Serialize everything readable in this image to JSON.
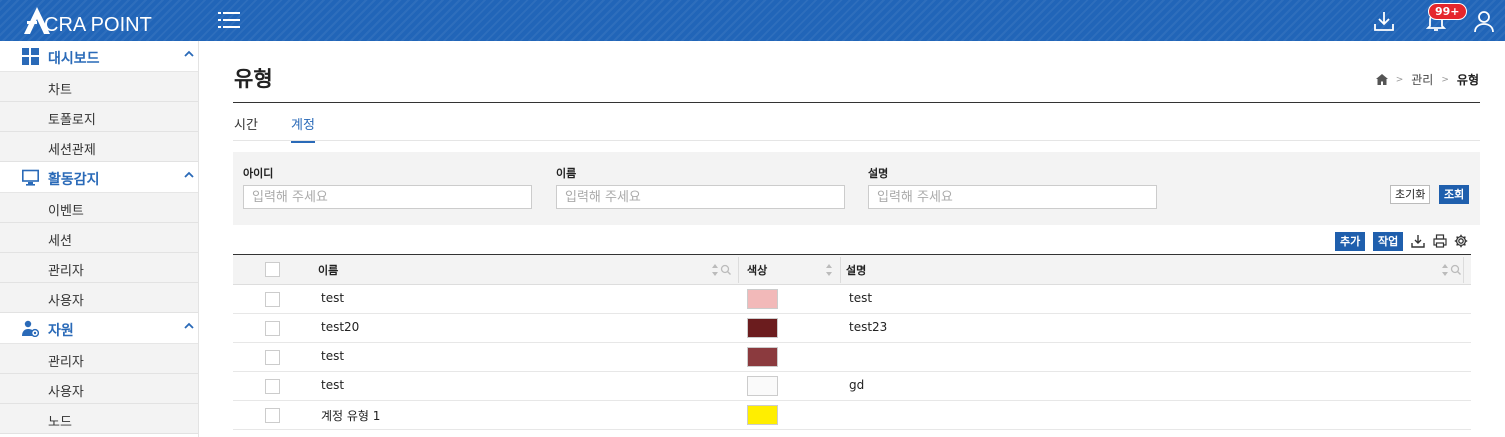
{
  "app": {
    "logo_text": "CRA POINT",
    "notification_count": "99+"
  },
  "colors": {
    "brand": "#2165b8",
    "accent": "#1f5fad",
    "badge": "#e5262c"
  },
  "sidebar": {
    "groups": [
      {
        "label": "대시보드",
        "icon": "dashboard-grid-icon",
        "items": [
          "차트",
          "토폴로지",
          "세션관제"
        ]
      },
      {
        "label": "활동감지",
        "icon": "monitor-icon",
        "items": [
          "이벤트",
          "세션",
          "관리자",
          "사용자"
        ]
      },
      {
        "label": "자원",
        "icon": "user-resource-icon",
        "items": [
          "관리자",
          "사용자",
          "노드"
        ]
      }
    ]
  },
  "page": {
    "title": "유형",
    "breadcrumb": [
      "관리",
      "유형"
    ]
  },
  "tabs": [
    {
      "label": "시간",
      "active": false
    },
    {
      "label": "계정",
      "active": true
    }
  ],
  "filter": {
    "fields": [
      {
        "label": "아이디",
        "placeholder": "입력해 주세요"
      },
      {
        "label": "이름",
        "placeholder": "입력해 주세요"
      },
      {
        "label": "설명",
        "placeholder": "입력해 주세요"
      }
    ],
    "reset_label": "초기화",
    "search_label": "조회"
  },
  "toolbar": {
    "add_label": "추가",
    "task_label": "작업"
  },
  "table": {
    "columns": [
      "이름",
      "색상",
      "설명"
    ],
    "rows": [
      {
        "name": "test",
        "color": "#f2b9b9",
        "desc": "test"
      },
      {
        "name": "test20",
        "color": "#6b1c1e",
        "desc": "test23"
      },
      {
        "name": "test",
        "color": "#8b3a3e",
        "desc": ""
      },
      {
        "name": "test",
        "color": "#fafafa",
        "desc": "gd"
      },
      {
        "name": "계정 유형 1",
        "color": "#ffee00",
        "desc": ""
      }
    ]
  }
}
